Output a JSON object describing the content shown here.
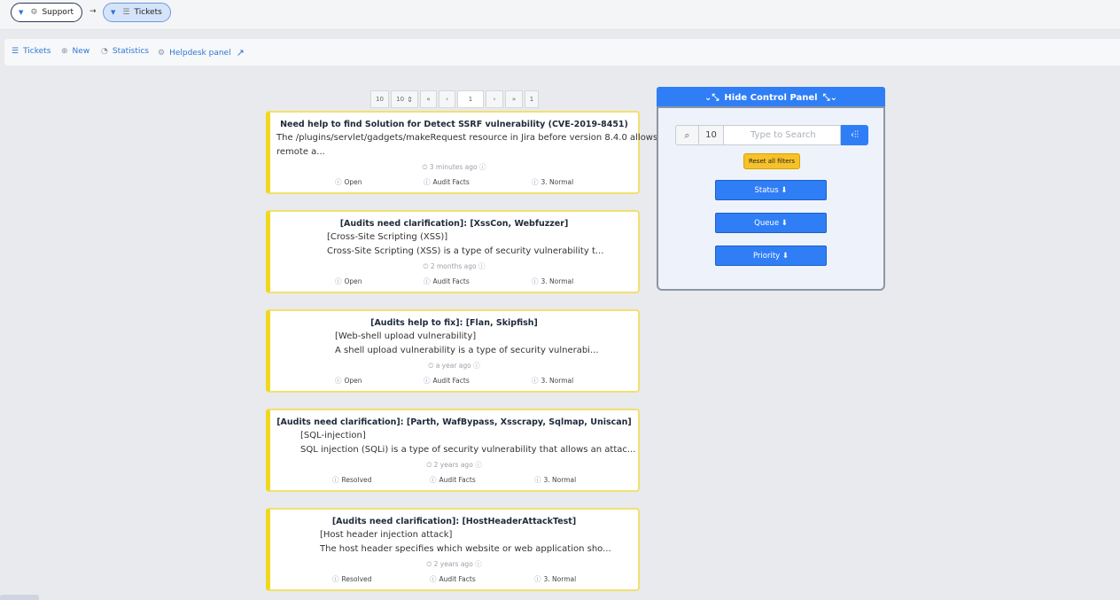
{
  "breadcrumb": {
    "items": [
      {
        "label": "Support",
        "icon": "gear-icon"
      },
      {
        "label": "Tickets",
        "icon": "list-icon"
      }
    ],
    "separator": "→"
  },
  "nav": {
    "items": [
      {
        "label": "Tickets",
        "icon": "list-icon"
      },
      {
        "label": "New",
        "icon": "plus-circle-icon"
      },
      {
        "label": "Statistics",
        "icon": "chart-icon"
      },
      {
        "label": "Helpdesk panel",
        "icon": "gear-icon",
        "external": true
      }
    ]
  },
  "pagination": {
    "per_page_display": "10",
    "per_page_select": "10",
    "first": "«",
    "prev": "‹",
    "current_page": "1",
    "next": "›",
    "last": "»",
    "total_pages": "1"
  },
  "tickets": [
    {
      "title": "Need help to find Solution for Detect SSRF vulnerability (CVE-2019-8451)",
      "line1": "The /plugins/servlet/gadgets/makeRequest resource in Jira before version 8.4.0 allows",
      "line2": "remote a...",
      "time": "3 minutes ago",
      "status": "Open",
      "queue": "Audit Facts",
      "priority": "3. Normal"
    },
    {
      "title": "[Audits need clarification]: [XssCon, Webfuzzer]",
      "line1": "[Cross-Site Scripting (XSS)]",
      "line2": "Cross-Site Scripting (XSS) is a type of security vulnerability t...",
      "time": "2 months ago",
      "status": "Open",
      "queue": "Audit Facts",
      "priority": "3. Normal"
    },
    {
      "title": "[Audits help to fix]: [Flan, Skipfish]",
      "line1": "[Web-shell upload vulnerability]",
      "line2": "A shell upload vulnerability is a type of security vulnerabi...",
      "time": "a year ago",
      "status": "Open",
      "queue": "Audit Facts",
      "priority": "3. Normal"
    },
    {
      "title": "[Audits need clarification]: [Parth, WafBypass, Xsscrapy, Sqlmap, Uniscan]",
      "line1": "[SQL-injection]",
      "line2": "SQL injection (SQLi) is a type of security vulnerability that allows an attac...",
      "time": "2 years ago",
      "status": "Resolved",
      "queue": "Audit Facts",
      "priority": "3. Normal"
    },
    {
      "title": "[Audits need clarification]: [HostHeaderAttackTest]",
      "line1": "[Host header injection attack]",
      "line2": "The host header specifies which website or web application sho...",
      "time": "2 years ago",
      "status": "Resolved",
      "queue": "Audit Facts",
      "priority": "3. Normal"
    }
  ],
  "control_panel": {
    "toggle_label": "Hide Control Panel",
    "search_count": "10",
    "search_placeholder": "Type to Search",
    "reset_label": "Reset all filters",
    "filters": [
      {
        "label": "Status ⬇"
      },
      {
        "label": "Queue ⬇"
      },
      {
        "label": "Priority ⬇"
      }
    ]
  },
  "colors": {
    "accent": "#2f7ef6",
    "card_border": "#f0d81e",
    "reset_button": "#f7c12a"
  }
}
